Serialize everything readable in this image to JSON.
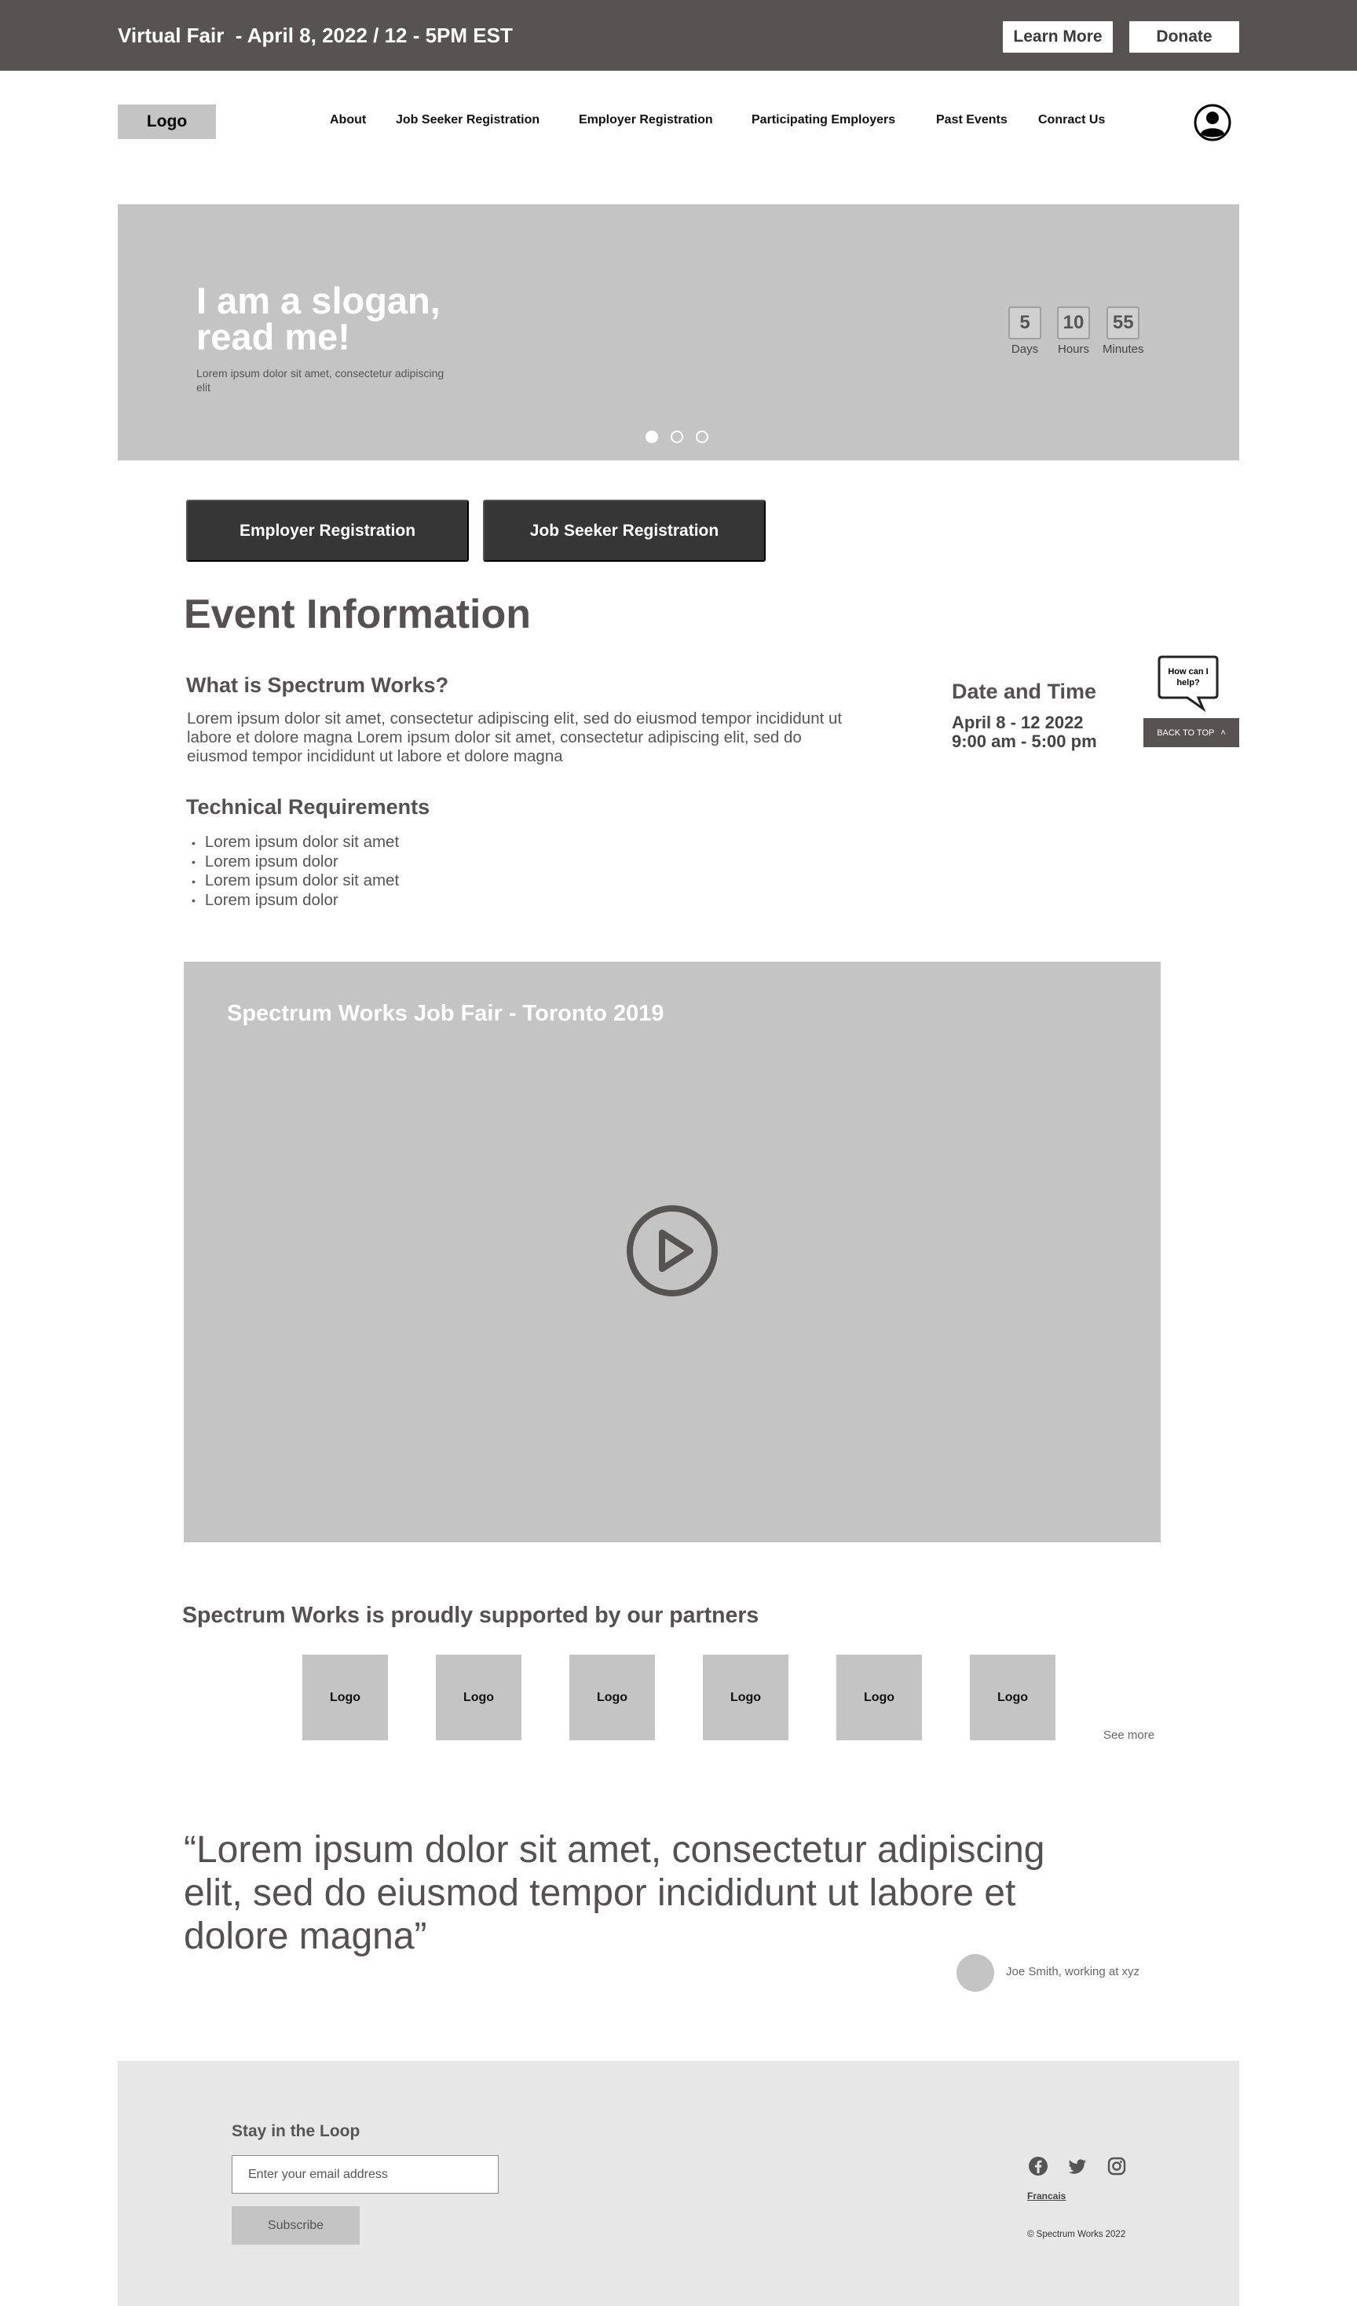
{
  "topbar": {
    "title": "Virtual Fair  - April 8, 2022 / 12 - 5PM EST",
    "learn_more": "Learn More",
    "donate": "Donate"
  },
  "nav": {
    "logo": "Logo",
    "items": [
      "About",
      "Job Seeker Registration",
      "Employer Registration",
      "Participating Employers",
      "Past Events",
      "Conract Us"
    ],
    "user_icon": "user-circle-icon"
  },
  "hero": {
    "slogan": "I am a slogan, read me!",
    "subtext": "Lorem ipsum dolor sit amet, consectetur adipiscing elit",
    "countdown": [
      {
        "value": "5",
        "label": "Days"
      },
      {
        "value": "10",
        "label": "Hours"
      },
      {
        "value": "55",
        "label": "Minutes"
      }
    ],
    "carousel_active": 0,
    "carousel_count": 3
  },
  "registration": {
    "employer": "Employer Registration",
    "job_seeker": "Job Seeker Registration"
  },
  "event": {
    "heading": "Event Information",
    "what_title": "What is Spectrum Works?",
    "what_body": "Lorem ipsum dolor sit amet, consectetur adipiscing elit, sed do eiusmod tempor incididunt ut labore et dolore magna Lorem ipsum dolor sit amet, consectetur adipiscing elit, sed do eiusmod tempor incididunt ut labore et dolore magna",
    "tech_title": "Technical Requirements",
    "tech_items": [
      "Lorem ipsum dolor sit amet",
      "Lorem ipsum dolor",
      "Lorem ipsum dolor sit amet",
      "Lorem ipsum dolor"
    ],
    "datetime_title": "Date and Time",
    "datetime_date": "April 8 - 12 2022",
    "datetime_time": "9:00 am - 5:00 pm"
  },
  "help": {
    "bubble": "How can I help?",
    "back_to_top": "BACK TO TOP"
  },
  "video": {
    "title": "Spectrum Works Job Fair - Toronto 2019",
    "play_icon": "play-circle-icon"
  },
  "partners": {
    "title": "Spectrum Works is proudly supported by our partners",
    "logos": [
      "Logo",
      "Logo",
      "Logo",
      "Logo",
      "Logo",
      "Logo"
    ],
    "see_more": "See more"
  },
  "testimonial": {
    "quote": "“Lorem ipsum dolor sit amet, consectetur adipiscing elit, sed do eiusmod tempor incididunt ut labore et dolore magna”",
    "author": "Joe Smith, working at xyz"
  },
  "footer": {
    "loop_title": "Stay in the Loop",
    "email_placeholder": "Enter your email address",
    "subscribe": "Subscribe",
    "social": [
      "facebook-icon",
      "twitter-icon",
      "instagram-icon"
    ],
    "language": "Francais",
    "copyright": "© Spectrum Works 2022"
  }
}
